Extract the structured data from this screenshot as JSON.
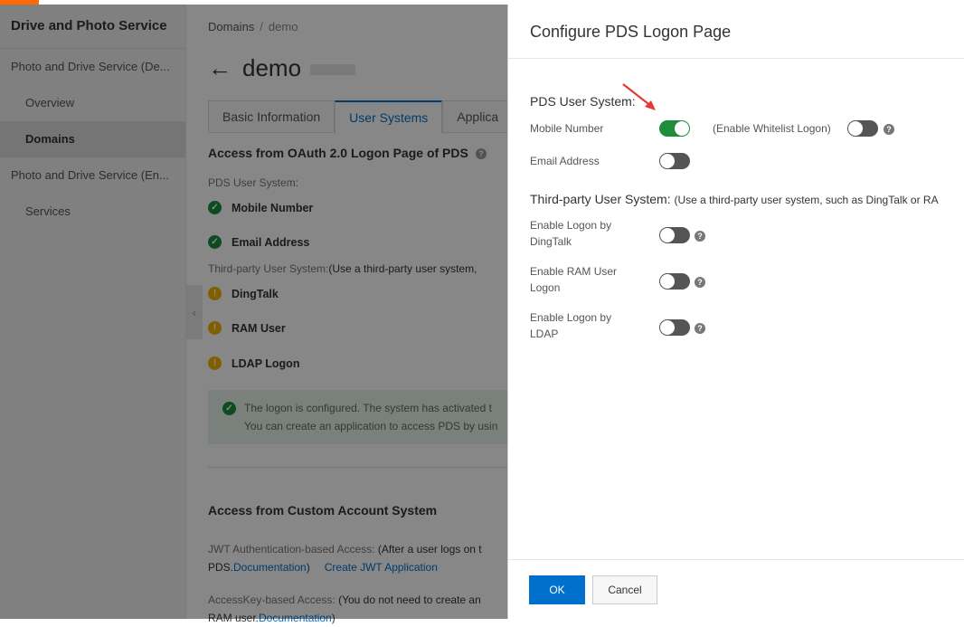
{
  "sidebar": {
    "title": "Drive and Photo Service",
    "items": [
      {
        "label": "Photo and Drive Service (De..."
      },
      {
        "label": "Overview"
      },
      {
        "label": "Domains"
      },
      {
        "label": "Photo and Drive Service (En..."
      },
      {
        "label": "Services"
      }
    ]
  },
  "breadcrumb": {
    "root": "Domains",
    "sep": "/",
    "current": "demo"
  },
  "page": {
    "title": "demo",
    "back": "←"
  },
  "tabs": [
    {
      "label": "Basic Information"
    },
    {
      "label": "User Systems"
    },
    {
      "label": "Applica"
    }
  ],
  "oauth": {
    "heading": "Access from OAuth 2.0 Logon Page of PDS",
    "pds_label": "PDS User System:",
    "pds_items": [
      "Mobile Number",
      "Email Address"
    ],
    "third_label": "Third-party User System:",
    "third_note": "(Use a third-party user system,",
    "third_items": [
      "DingTalk",
      "RAM User",
      "LDAP Logon"
    ],
    "alert_line1": "The logon is configured. The system has activated t",
    "alert_line2": "You can create an application to access PDS by usin"
  },
  "custom": {
    "heading": "Access from Custom Account System",
    "jwt_label": "JWT Authentication-based Access:",
    "jwt_note": "(After a user logs on t",
    "jwt_line2": "PDS.",
    "doc": "Documentation",
    "jwt_close": ")",
    "create_jwt": "Create JWT Application",
    "ak_label": "AccessKey-based Access:",
    "ak_note": "(You do not need to create an",
    "ak_line2": "RAM user.",
    "ak_close": ")"
  },
  "dialog": {
    "title": "Configure PDS Logon Page",
    "pds_heading": "PDS User System:",
    "mobile_label": "Mobile Number",
    "mobile_on": true,
    "whitelist_label": "(Enable Whitelist Logon)",
    "whitelist_on": false,
    "email_label": "Email Address",
    "email_on": false,
    "third_heading": "Third-party User System:",
    "third_note": "(Use a third-party user system, such as DingTalk or RA",
    "dingtalk_l1": "Enable Logon by",
    "dingtalk_l2": "DingTalk",
    "ram_l1": "Enable RAM User",
    "ram_l2": "Logon",
    "ldap_l1": "Enable Logon by",
    "ldap_l2": "LDAP",
    "ok": "OK",
    "cancel": "Cancel"
  },
  "colors": {
    "accent": "#0070cc",
    "success": "#1e8e3e",
    "brand": "#ff6a00",
    "arrow": "#e53935"
  }
}
